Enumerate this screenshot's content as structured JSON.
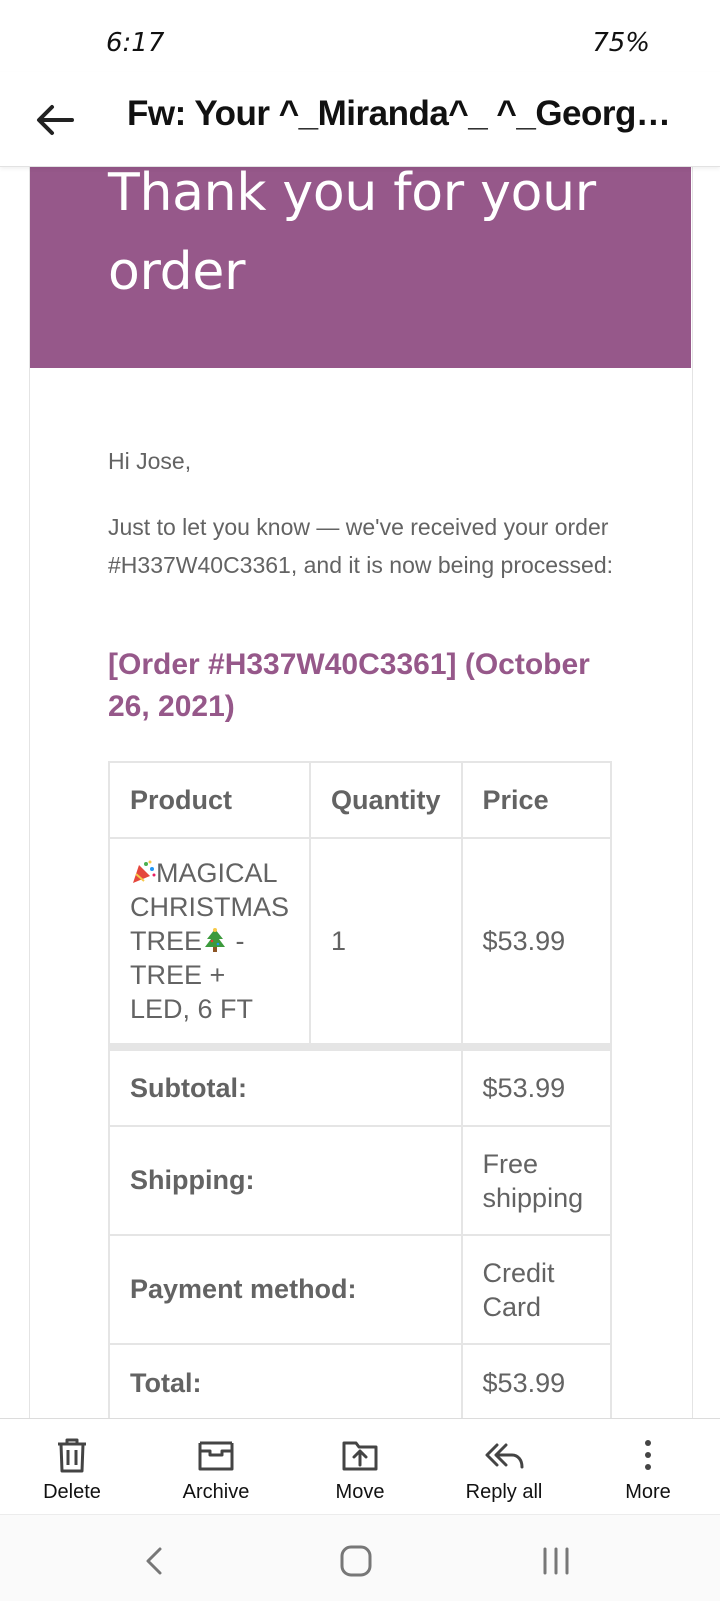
{
  "status_bar": {
    "time": "6:17",
    "battery": "75%"
  },
  "header": {
    "title": "Fw: Your ^_Miranda^_ ^_George^..."
  },
  "email": {
    "banner_heading": "Thank you for your order",
    "greeting": "Hi Jose,",
    "intro": "Just to let you know — we've received your order #H337W40C3361, and it is now being processed:",
    "order_heading": "[Order #H337W40C3361] (October 26, 2021)",
    "table": {
      "headers": [
        "Product",
        "Quantity",
        "Price"
      ],
      "items": [
        {
          "product": "MAGICAL CHRISTMAS TREE - TREE + LED, 6 FT",
          "product_part1": "MAGICAL CHRISTMAS TREE",
          "product_part2": " - TREE + LED, 6 FT",
          "quantity": "1",
          "price": "$53.99"
        }
      ],
      "totals": [
        {
          "label": "Subtotal:",
          "value": "$53.99"
        },
        {
          "label": "Shipping:",
          "value": "Free shipping"
        },
        {
          "label": "Payment method:",
          "value": "Credit Card"
        },
        {
          "label": "Total:",
          "value": "$53.99"
        }
      ]
    }
  },
  "actions": [
    {
      "label": "Delete",
      "icon": "trash-icon"
    },
    {
      "label": "Archive",
      "icon": "archive-icon"
    },
    {
      "label": "Move",
      "icon": "move-icon"
    },
    {
      "label": "Reply all",
      "icon": "reply-all-icon"
    },
    {
      "label": "More",
      "icon": "more-vertical-icon"
    }
  ],
  "colors": {
    "accent": "#96588a",
    "text": "#636363",
    "border": "#e5e5e5"
  }
}
